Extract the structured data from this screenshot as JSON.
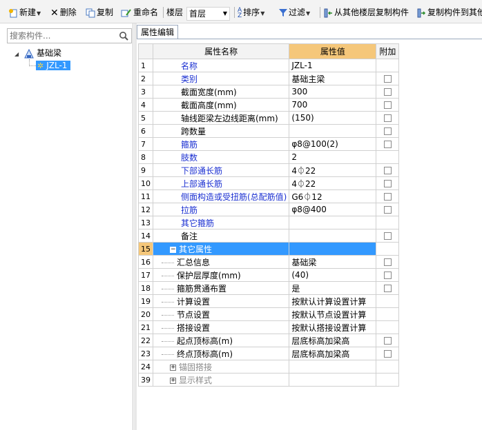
{
  "toolbar": {
    "new_label": "新建",
    "delete_label": "删除",
    "copy_label": "复制",
    "rename_label": "重命名",
    "floor_label": "楼层",
    "floor_value": "首层",
    "sort_label": "排序",
    "filter_label": "过滤",
    "copy_from_floor_label": "从其他楼层复制构件",
    "copy_to_floor_label": "复制构件到其他"
  },
  "search": {
    "placeholder": "搜索构件..."
  },
  "tree": {
    "root_label": "基础梁",
    "child_label": "JZL-1"
  },
  "tab": {
    "label": "属性编辑"
  },
  "grid": {
    "headers": {
      "name": "属性名称",
      "value": "属性值",
      "extra": "附加"
    },
    "rows": [
      {
        "num": "1",
        "name": "名称",
        "value": "JZL-1",
        "style": "blue",
        "checkbox": false,
        "indent": false
      },
      {
        "num": "2",
        "name": "类别",
        "value": "基础主梁",
        "style": "blue",
        "checkbox": true,
        "indent": false
      },
      {
        "num": "3",
        "name": "截面宽度(mm)",
        "value": "300",
        "style": "black",
        "checkbox": true,
        "indent": false
      },
      {
        "num": "4",
        "name": "截面高度(mm)",
        "value": "700",
        "style": "black",
        "checkbox": true,
        "indent": false
      },
      {
        "num": "5",
        "name": "轴线距梁左边线距离(mm)",
        "value": "(150)",
        "style": "black",
        "checkbox": true,
        "indent": false
      },
      {
        "num": "6",
        "name": "跨数量",
        "value": "",
        "style": "black",
        "checkbox": true,
        "indent": false
      },
      {
        "num": "7",
        "name": "箍筋",
        "value": "φ8@100(2)",
        "style": "blue",
        "checkbox": true,
        "indent": false
      },
      {
        "num": "8",
        "name": "肢数",
        "value": "2",
        "style": "blue",
        "checkbox": false,
        "indent": false
      },
      {
        "num": "9",
        "name": "下部通长筋",
        "value": "4⏀22",
        "style": "blue",
        "checkbox": true,
        "indent": false
      },
      {
        "num": "10",
        "name": "上部通长筋",
        "value": "4⏀22",
        "style": "blue",
        "checkbox": true,
        "indent": false
      },
      {
        "num": "11",
        "name": "侧面构造或受扭筋(总配筋值)",
        "value": "G6⏀12",
        "style": "blue",
        "checkbox": true,
        "indent": false
      },
      {
        "num": "12",
        "name": "拉筋",
        "value": "φ8@400",
        "style": "blue",
        "checkbox": true,
        "indent": false
      },
      {
        "num": "13",
        "name": "其它箍筋",
        "value": "",
        "style": "blue",
        "checkbox": false,
        "indent": false
      },
      {
        "num": "14",
        "name": "备注",
        "value": "",
        "style": "black",
        "checkbox": true,
        "indent": false
      },
      {
        "num": "15",
        "name": "其它属性",
        "value": "",
        "style": "group",
        "checkbox": false,
        "indent": false,
        "expander": "−",
        "selected": true
      },
      {
        "num": "16",
        "name": "汇总信息",
        "value": "基础梁",
        "style": "black",
        "checkbox": true,
        "indent": true
      },
      {
        "num": "17",
        "name": "保护层厚度(mm)",
        "value": "(40)",
        "style": "black",
        "checkbox": true,
        "indent": true
      },
      {
        "num": "18",
        "name": "箍筋贯通布置",
        "value": "是",
        "style": "black",
        "checkbox": true,
        "indent": true
      },
      {
        "num": "19",
        "name": "计算设置",
        "value": "按默认计算设置计算",
        "style": "black",
        "checkbox": false,
        "indent": true
      },
      {
        "num": "20",
        "name": "节点设置",
        "value": "按默认节点设置计算",
        "style": "black",
        "checkbox": false,
        "indent": true
      },
      {
        "num": "21",
        "name": "搭接设置",
        "value": "按默认搭接设置计算",
        "style": "black",
        "checkbox": false,
        "indent": true
      },
      {
        "num": "22",
        "name": "起点顶标高(m)",
        "value": "层底标高加梁高",
        "style": "black",
        "checkbox": true,
        "indent": true
      },
      {
        "num": "23",
        "name": "终点顶标高(m)",
        "value": "层底标高加梁高",
        "style": "black",
        "checkbox": true,
        "indent": true
      },
      {
        "num": "24",
        "name": "锚固搭接",
        "value": "",
        "style": "gray",
        "checkbox": false,
        "indent": false,
        "expander": "+"
      },
      {
        "num": "39",
        "name": "显示样式",
        "value": "",
        "style": "gray",
        "checkbox": false,
        "indent": false,
        "expander": "+"
      }
    ]
  },
  "colors": {
    "header_value_bg": "#f5c77a",
    "selection_bg": "#3399ff",
    "link_blue": "#1a2fd1"
  }
}
